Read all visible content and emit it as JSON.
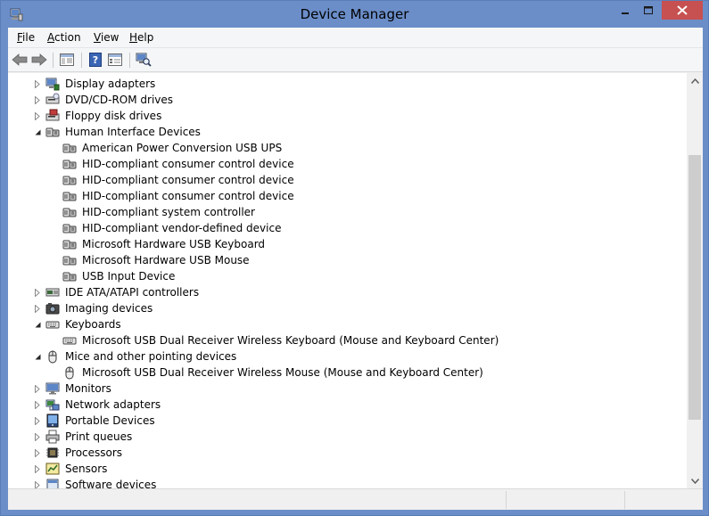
{
  "window": {
    "title": "Device Manager",
    "colors": {
      "frame": "#6b8ec9",
      "close": "#c75050"
    }
  },
  "menu": [
    {
      "label_u": "F",
      "label_rest": "ile"
    },
    {
      "label_u": "A",
      "label_rest": "ction"
    },
    {
      "label_u": "V",
      "label_rest": "iew"
    },
    {
      "label_u": "H",
      "label_rest": "elp"
    }
  ],
  "toolbar": {
    "icons": [
      "back-arrow-icon",
      "forward-arrow-icon",
      "show-hide-console-tree-icon",
      "help-icon",
      "properties-icon",
      "scan-hardware-icon"
    ]
  },
  "tree": {
    "rows": [
      {
        "label": "Display adapters",
        "state": "collapsed",
        "icon": "display-adapter-icon"
      },
      {
        "label": "DVD/CD-ROM drives",
        "state": "collapsed",
        "icon": "dvd-drive-icon"
      },
      {
        "label": "Floppy disk drives",
        "state": "collapsed",
        "icon": "floppy-drive-icon"
      },
      {
        "label": "Human Interface Devices",
        "state": "expanded",
        "icon": "hid-icon"
      },
      {
        "label": "American Power Conversion USB UPS",
        "state": "child",
        "icon": "hid-icon"
      },
      {
        "label": "HID-compliant consumer control device",
        "state": "child",
        "icon": "hid-icon"
      },
      {
        "label": "HID-compliant consumer control device",
        "state": "child",
        "icon": "hid-icon"
      },
      {
        "label": "HID-compliant consumer control device",
        "state": "child",
        "icon": "hid-icon"
      },
      {
        "label": "HID-compliant system controller",
        "state": "child",
        "icon": "hid-icon"
      },
      {
        "label": "HID-compliant vendor-defined device",
        "state": "child",
        "icon": "hid-icon"
      },
      {
        "label": "Microsoft Hardware USB Keyboard",
        "state": "child",
        "icon": "hid-icon"
      },
      {
        "label": "Microsoft Hardware USB Mouse",
        "state": "child",
        "icon": "hid-icon"
      },
      {
        "label": "USB Input Device",
        "state": "child",
        "icon": "hid-icon"
      },
      {
        "label": "IDE ATA/ATAPI controllers",
        "state": "collapsed",
        "icon": "ide-controller-icon"
      },
      {
        "label": "Imaging devices",
        "state": "collapsed",
        "icon": "camera-icon"
      },
      {
        "label": "Keyboards",
        "state": "expanded",
        "icon": "keyboard-icon"
      },
      {
        "label": "Microsoft USB Dual Receiver Wireless Keyboard (Mouse and Keyboard Center)",
        "state": "child",
        "icon": "keyboard-icon"
      },
      {
        "label": "Mice and other pointing devices",
        "state": "expanded",
        "icon": "mouse-icon"
      },
      {
        "label": "Microsoft USB Dual Receiver Wireless Mouse (Mouse and Keyboard Center)",
        "state": "child",
        "icon": "mouse-icon"
      },
      {
        "label": "Monitors",
        "state": "collapsed",
        "icon": "monitor-icon"
      },
      {
        "label": "Network adapters",
        "state": "collapsed",
        "icon": "network-adapter-icon"
      },
      {
        "label": "Portable Devices",
        "state": "collapsed",
        "icon": "portable-device-icon"
      },
      {
        "label": "Print queues",
        "state": "collapsed",
        "icon": "printer-icon"
      },
      {
        "label": "Processors",
        "state": "collapsed",
        "icon": "processor-icon"
      },
      {
        "label": "Sensors",
        "state": "collapsed",
        "icon": "sensor-icon"
      },
      {
        "label": "Software devices",
        "state": "collapsed",
        "icon": "software-device-icon"
      }
    ]
  }
}
